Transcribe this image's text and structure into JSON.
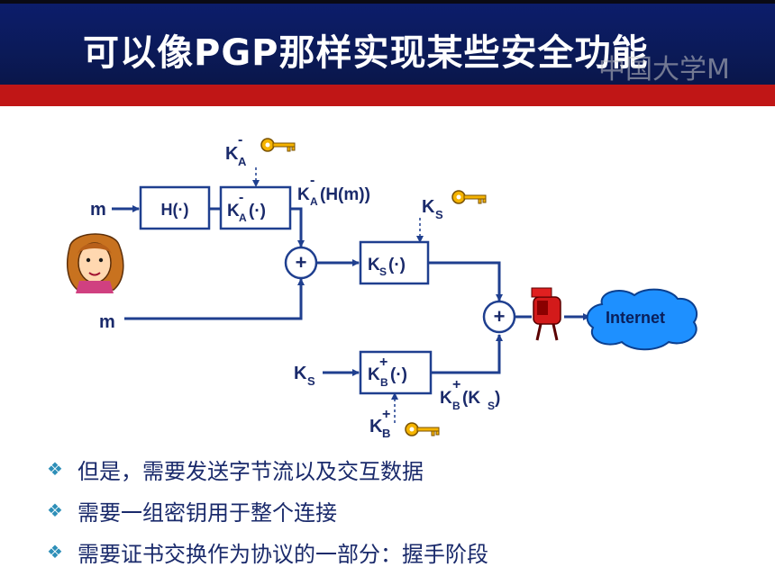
{
  "slide": {
    "title": "可以像PGP那样实现某些安全功能",
    "watermark": "中国大学M"
  },
  "diagram": {
    "m_top": "m",
    "m_bottom": "m",
    "hash_box": "H(·)",
    "ka_box_K": "K",
    "ka_box_sub": "A",
    "ka_box_sup": "-",
    "ka_box_tail": "(·)",
    "ka_key_K": "K",
    "ka_key_sub": "A",
    "ka_key_sup": "-",
    "ka_out_K": "K",
    "ka_out_sub": "A",
    "ka_out_sup": "-",
    "ka_out_tail": "(H(m))",
    "ks_key_K": "K",
    "ks_key_sub": "S",
    "ks_box_K": "K",
    "ks_box_sub": "S",
    "ks_box_tail": "(·)",
    "ks_in_K": "K",
    "ks_in_sub": "S",
    "kb_box_K": "K",
    "kb_box_sub": "B",
    "kb_box_sup": "+",
    "kb_box_tail": "(·)",
    "kb_out_K": "K",
    "kb_out_sub": "B",
    "kb_out_sup": "+",
    "kb_out_tail": "(K",
    "kb_out_tail_sub": "S",
    "kb_out_tail_end": " )",
    "kb_key_K": "K",
    "kb_key_sub": "B",
    "kb_key_sup": "+",
    "plus": "+",
    "cloud": "Internet"
  },
  "bullets": [
    "但是，需要发送字节流以及交互数据",
    "需要一组密钥用于整个连接",
    "需要证书交换作为协议的一部分：握手阶段"
  ],
  "bullet_glyph": "❖",
  "colors": {
    "title_bg": "#0c1d6b",
    "accent_red": "#c01616",
    "line": "#1f3f8f",
    "text": "#1a2a6b",
    "cloud": "#1e90ff",
    "key": "#f5b400"
  }
}
